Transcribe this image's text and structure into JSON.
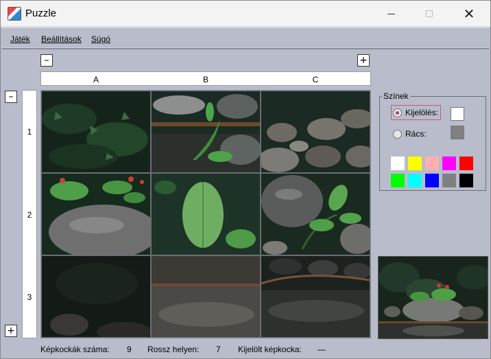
{
  "window": {
    "title": "Puzzle",
    "icon": "puzzle-app-icon"
  },
  "menu": {
    "jatek": "Játék",
    "beallitasok": "Beállítások",
    "sugo": "Súgó"
  },
  "grid_controls": {
    "minus": "–",
    "plus": "+"
  },
  "columns": [
    "A",
    "B",
    "C"
  ],
  "rows": [
    "1",
    "2",
    "3"
  ],
  "colors_panel": {
    "title": "Színek",
    "selection_label": "Kijelölés:",
    "grid_label": "Rács:",
    "selection_color": "#ffffff",
    "grid_color": "#808080",
    "selected_option": "Kijelölés",
    "palette": [
      "#ffffff",
      "#ffff00",
      "#ffafaf",
      "#ff00ff",
      "#ff0000",
      "#00ff00",
      "#00ffff",
      "#0000ff",
      "#808080",
      "#000000"
    ]
  },
  "status": {
    "count_label": "Képkockák száma:",
    "count_value": "9",
    "wrong_label": "Rossz helyen:",
    "wrong_value": "7",
    "selected_label": "Kijelölt képkocka:",
    "selected_value": "—"
  }
}
